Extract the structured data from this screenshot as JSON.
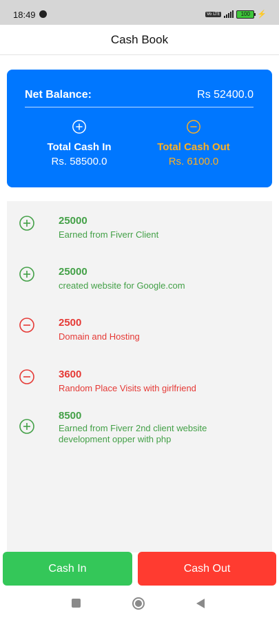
{
  "status_bar": {
    "time": "18:49",
    "network_badge": "Vo LTE",
    "battery": "100"
  },
  "header": {
    "title": "Cash Book"
  },
  "summary": {
    "net_balance_label": "Net Balance:",
    "net_balance_value": "Rs 52400.0",
    "cash_in": {
      "icon": "plus-circle-icon",
      "label": "Total Cash In",
      "amount": "Rs. 58500.0"
    },
    "cash_out": {
      "icon": "minus-circle-icon",
      "label": "Total Cash Out",
      "amount": "Rs. 6100.0",
      "color": "#ffb020"
    }
  },
  "transactions": [
    {
      "type": "in",
      "amount": "25000",
      "description": "Earned from Fiverr Client"
    },
    {
      "type": "in",
      "amount": "25000",
      "description": "created website for Google.com"
    },
    {
      "type": "out",
      "amount": "2500",
      "description": "Domain and Hosting"
    },
    {
      "type": "out",
      "amount": "3600",
      "description": "Random Place Visits with girlfriend"
    },
    {
      "type": "in",
      "amount": "8500",
      "description": "Earned from Fiverr 2nd client website development opper with php"
    }
  ],
  "actions": {
    "cash_in_label": "Cash In",
    "cash_out_label": "Cash Out"
  },
  "colors": {
    "primary": "#0077ff",
    "income": "#43a047",
    "expense": "#e53935",
    "cash_in_button": "#34c759",
    "cash_out_button": "#ff3b30"
  }
}
